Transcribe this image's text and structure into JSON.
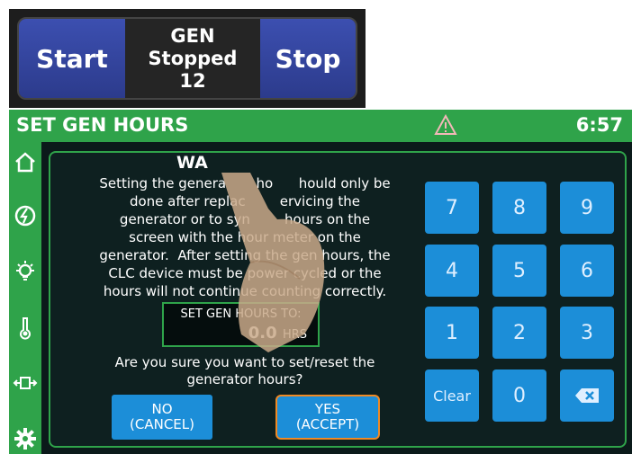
{
  "gen_control": {
    "start_label": "Start",
    "status_line1": "GEN",
    "status_line2": "Stopped",
    "status_line3": "12",
    "stop_label": "Stop"
  },
  "titlebar": {
    "title": "SET GEN HOURS",
    "time": "6:57",
    "warning_icon": "warning-triangle-icon"
  },
  "sidebar": {
    "items": [
      {
        "icon": "home-icon"
      },
      {
        "icon": "generator-icon"
      },
      {
        "icon": "lightbulb-icon"
      },
      {
        "icon": "thermometer-icon"
      },
      {
        "icon": "slideout-icon"
      },
      {
        "icon": "settings-gear-icon"
      }
    ]
  },
  "dialog": {
    "warning_title": "WA",
    "warning_lines": [
      "Setting the genera       ho      hould only be",
      "done after replac        ervicing the",
      "generator or to syn        hours on the",
      "screen with the hour meter on the",
      "generator.  After setting the gen hours, the",
      "CLC device must be power cycled or the",
      "hours will not continue counting correctly."
    ],
    "hours_label": "SET GEN HOURS TO:",
    "hours_value": "0.0",
    "hours_unit": "HRS",
    "confirm_line1": "Are you sure you want to set/reset the",
    "confirm_line2": "generator hours?",
    "no_line1": "NO",
    "no_line2": "(CANCEL)",
    "yes_line1": "YES",
    "yes_line2": "(ACCEPT)"
  },
  "keypad": {
    "keys": [
      "7",
      "8",
      "9",
      "4",
      "5",
      "6",
      "1",
      "2",
      "3",
      "Clear",
      "0"
    ],
    "backspace_icon": "backspace-icon"
  },
  "colors": {
    "accent_green": "#2fa34a",
    "key_blue": "#1c8ed8",
    "highlight_orange": "#f08a24",
    "gen_button_blue": "#3c4fb0"
  }
}
